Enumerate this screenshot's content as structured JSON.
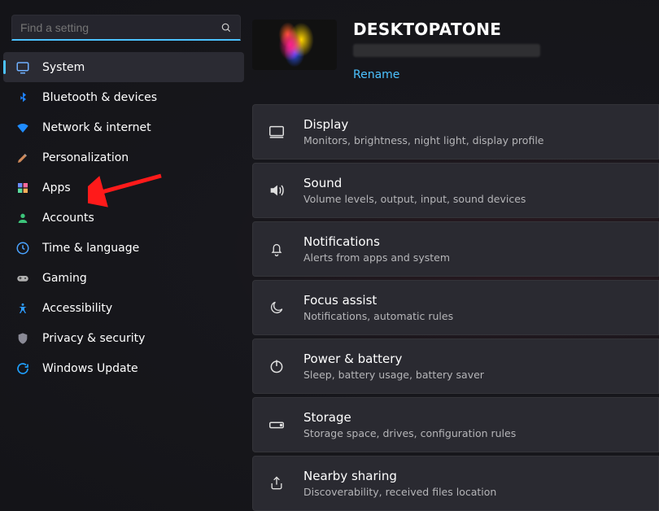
{
  "search": {
    "placeholder": "Find a setting"
  },
  "sidebar": {
    "items": [
      {
        "label": "System",
        "icon": "system"
      },
      {
        "label": "Bluetooth & devices",
        "icon": "bluetooth"
      },
      {
        "label": "Network & internet",
        "icon": "wifi"
      },
      {
        "label": "Personalization",
        "icon": "brush"
      },
      {
        "label": "Apps",
        "icon": "apps"
      },
      {
        "label": "Accounts",
        "icon": "person"
      },
      {
        "label": "Time & language",
        "icon": "clock-globe"
      },
      {
        "label": "Gaming",
        "icon": "gamepad"
      },
      {
        "label": "Accessibility",
        "icon": "a11y"
      },
      {
        "label": "Privacy & security",
        "icon": "shield"
      },
      {
        "label": "Windows Update",
        "icon": "update"
      }
    ],
    "selected_index": 0
  },
  "header": {
    "pc_name": "DESKTOPATONE",
    "rename_label": "Rename"
  },
  "cards": [
    {
      "title": "Display",
      "sub": "Monitors, brightness, night light, display profile",
      "icon": "display"
    },
    {
      "title": "Sound",
      "sub": "Volume levels, output, input, sound devices",
      "icon": "sound"
    },
    {
      "title": "Notifications",
      "sub": "Alerts from apps and system",
      "icon": "bell"
    },
    {
      "title": "Focus assist",
      "sub": "Notifications, automatic rules",
      "icon": "moon"
    },
    {
      "title": "Power & battery",
      "sub": "Sleep, battery usage, battery saver",
      "icon": "power"
    },
    {
      "title": "Storage",
      "sub": "Storage space, drives, configuration rules",
      "icon": "storage"
    },
    {
      "title": "Nearby sharing",
      "sub": "Discoverability, received files location",
      "icon": "share"
    }
  ]
}
